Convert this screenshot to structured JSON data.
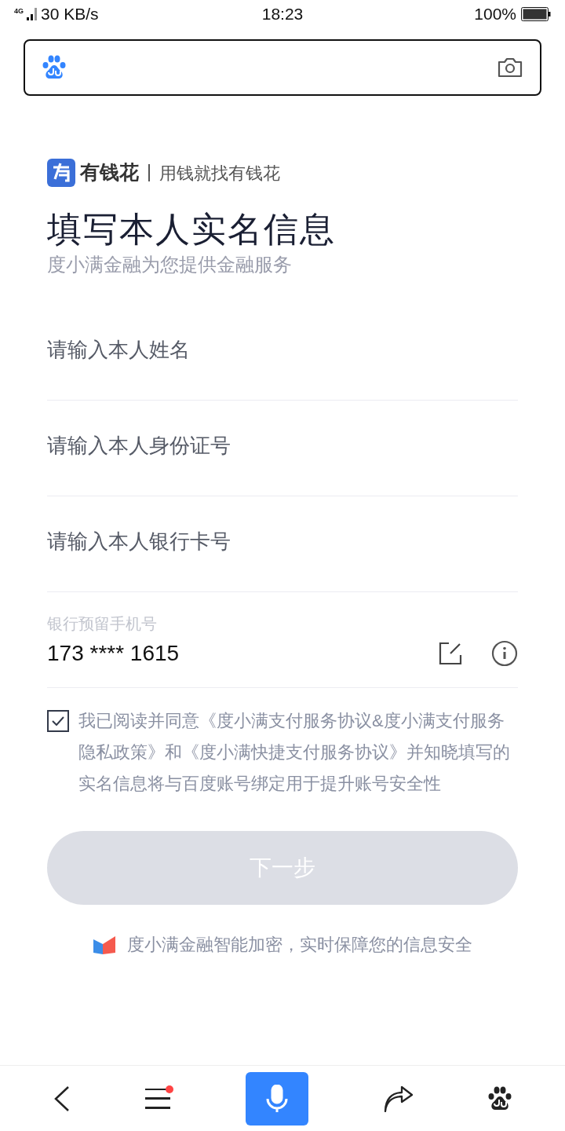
{
  "status_bar": {
    "network": "4G",
    "speed": "30 KB/s",
    "time": "18:23",
    "battery": "100%"
  },
  "brand": {
    "name": "有钱花",
    "slogan": "用钱就找有钱花"
  },
  "title": "填写本人实名信息",
  "subtitle": "度小满金融为您提供金融服务",
  "fields": [
    {
      "placeholder": "请输入本人姓名"
    },
    {
      "placeholder": "请输入本人身份证号"
    },
    {
      "placeholder": "请输入本人银行卡号"
    }
  ],
  "phone": {
    "label": "银行预留手机号",
    "value": "173 **** 1615"
  },
  "agreement": {
    "checked": true,
    "text": "我已阅读并同意《度小满支付服务协议&度小满支付服务隐私政策》和《度小满快捷支付服务协议》并知晓填写的实名信息将与百度账号绑定用于提升账号安全性"
  },
  "next_button": {
    "label": "下一步",
    "disabled": true
  },
  "security_note": "度小满金融智能加密，实时保障您的信息安全",
  "bottom_nav": {
    "menu_badge": true
  }
}
